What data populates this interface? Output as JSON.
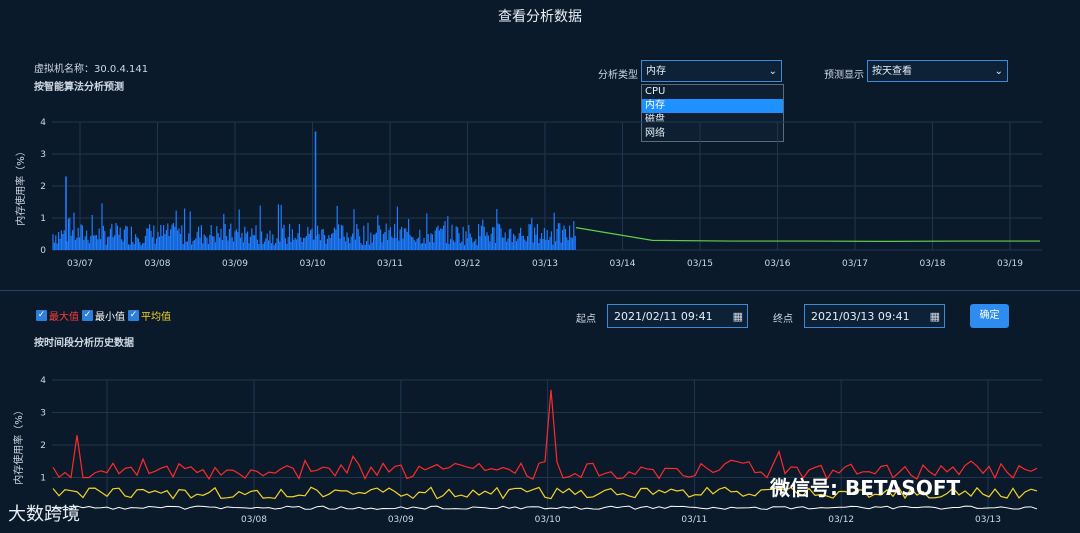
{
  "page_title": "查看分析数据",
  "vm_name": "虚拟机名称：30.0.4.141",
  "top_section": {
    "title": "按智能算法分析预测",
    "analysis_type_label": "分析类型",
    "analysis_type_value": "内存",
    "analysis_type_options": [
      "CPU",
      "内存",
      "磁盘",
      "网络"
    ],
    "forecast_label": "预测显示",
    "forecast_value": "按天查看"
  },
  "bottom_section": {
    "title": "按时间段分析历史数据",
    "checkboxes": [
      {
        "label": "最大值",
        "color": "#ff3b3b",
        "checked": true
      },
      {
        "label": "最小值",
        "color": "#ffffff",
        "checked": true
      },
      {
        "label": "平均值",
        "color": "#f5d327",
        "checked": true
      }
    ],
    "start_label": "起点",
    "start_value": "2021/02/11 09:41",
    "end_label": "终点",
    "end_value": "2021/03/13 09:41",
    "confirm_label": "确定"
  },
  "colors": {
    "history_bar": "#1e7cff",
    "forecast": "#5fcf4a",
    "max": "#ff2a2a",
    "avg": "#f5d327",
    "min": "#ffffff"
  },
  "chart_data": [
    {
      "type": "bar",
      "ylabel": "内存使用率（%）",
      "x_ticks": [
        "03/07",
        "03/08",
        "03/09",
        "03/10",
        "03/11",
        "03/12",
        "03/13",
        "03/14",
        "03/15",
        "03/16",
        "03/17",
        "03/18",
        "03/19"
      ],
      "y_ticks": [
        "0",
        "1",
        "2",
        "3",
        "4"
      ],
      "ylim": [
        0,
        4
      ],
      "series": [
        {
          "name": "",
          "type": "bar",
          "note_peaks": [
            {
              "x": "03/07",
              "y": 2.3
            },
            {
              "x": "03/10",
              "y": 3.7
            }
          ]
        },
        {
          "name": "",
          "type": "line",
          "x": [
            "03/13",
            "03/14",
            "03/15",
            "03/16",
            "03/17",
            "03/18",
            "03/19"
          ],
          "values": [
            0.7,
            0.3,
            0.28,
            0.28,
            0.27,
            0.28,
            0.28
          ]
        }
      ]
    },
    {
      "type": "line",
      "ylabel": "内存使用率（%）",
      "x_ticks": [
        "03/08",
        "03/09",
        "03/10",
        "03/11",
        "03/12",
        "03/13"
      ],
      "y_ticks": [
        "1",
        "2",
        "3",
        "4"
      ],
      "ylim": [
        0,
        4
      ],
      "series": [
        {
          "name": "最大值",
          "peaks": [
            {
              "x": "03/07",
              "y": 2.3
            },
            {
              "x": "03/10",
              "y": 3.7
            }
          ]
        },
        {
          "name": "平均值"
        },
        {
          "name": "最小值"
        }
      ]
    }
  ],
  "watermark_left": "大数跨境",
  "watermark_right": "微信号: BETASOFT"
}
